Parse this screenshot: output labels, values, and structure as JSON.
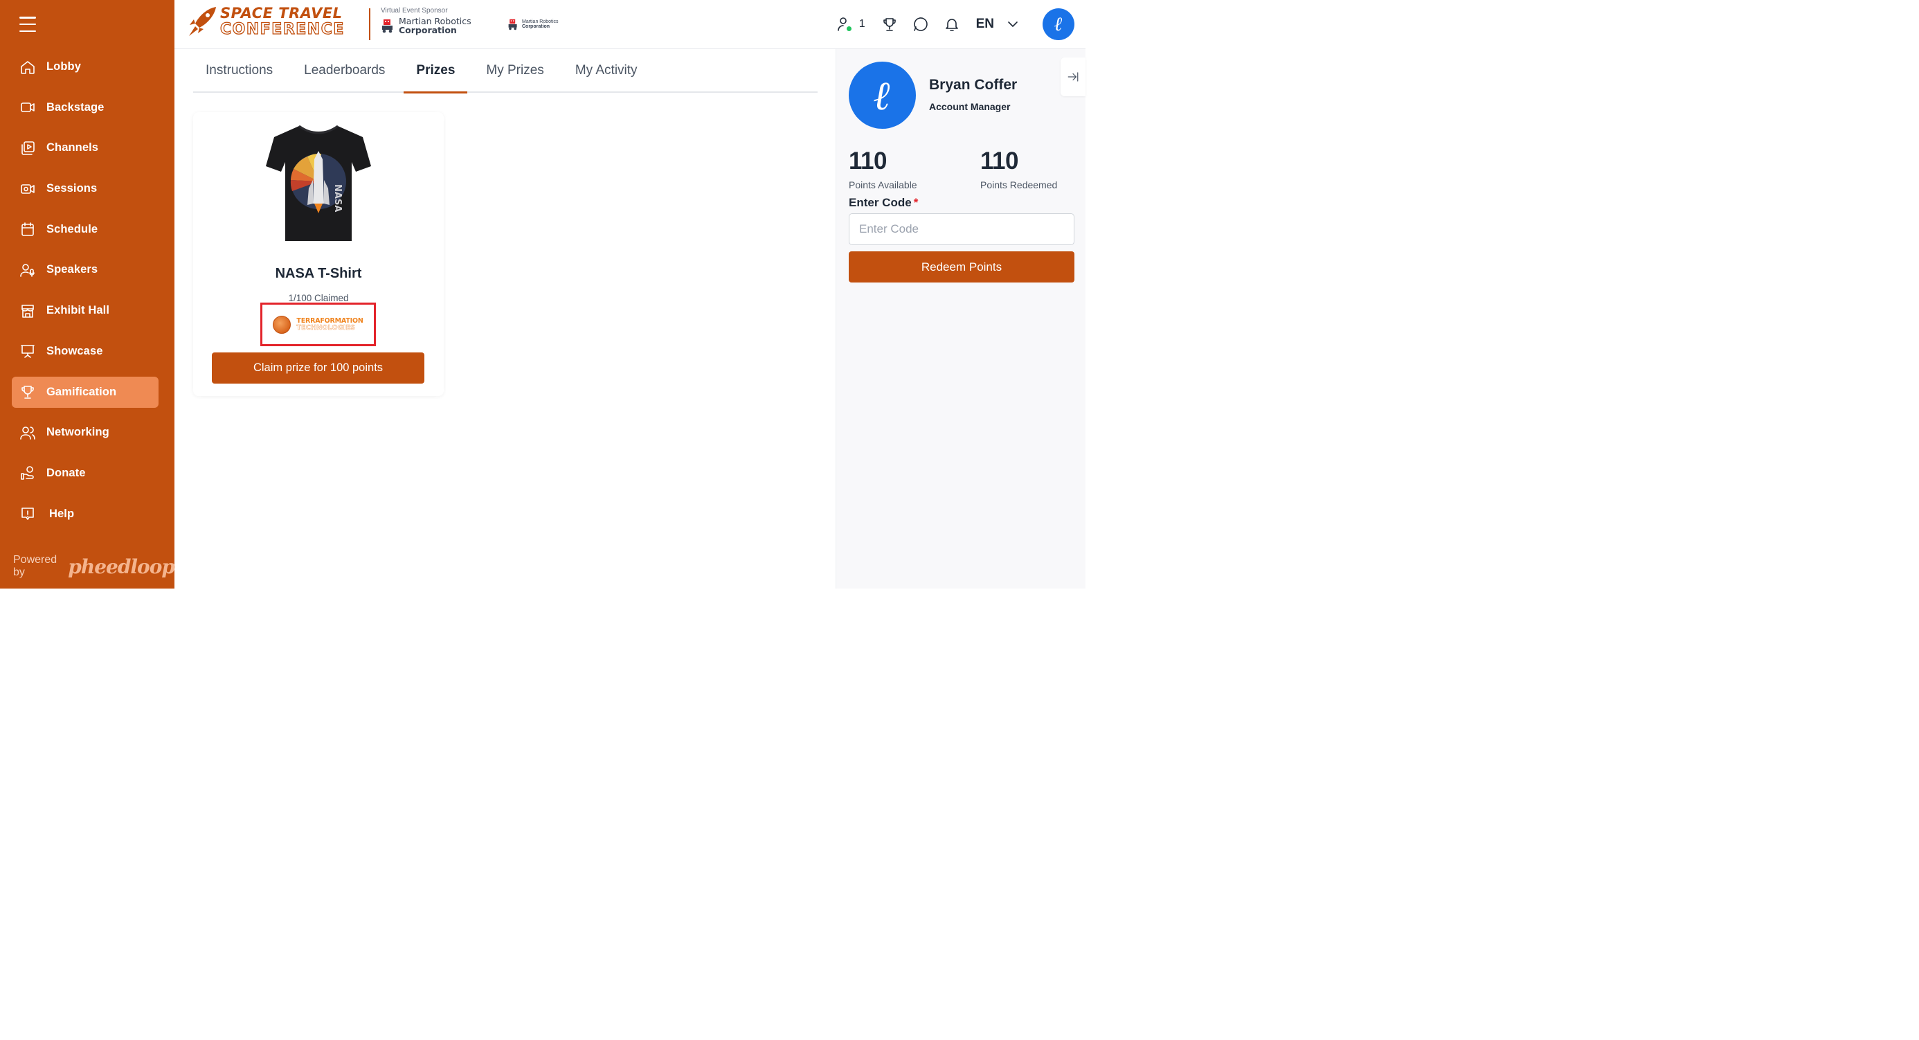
{
  "brand": {
    "line1": "SPACE TRAVEL",
    "line2": "CONFERENCE",
    "sponsor_label": "Virtual Event Sponsor",
    "sponsor_name_1": "Martian Robotics",
    "sponsor_name_2": "Corporation",
    "sponsor2_name_1": "Martian Robotics",
    "sponsor2_name_2": "Corporation"
  },
  "header": {
    "online_count": "1",
    "language": "EN",
    "avatar_letter": "ℓ"
  },
  "sidebar": {
    "items": [
      {
        "label": "Lobby",
        "icon": "home-icon"
      },
      {
        "label": "Backstage",
        "icon": "video-icon"
      },
      {
        "label": "Channels",
        "icon": "channels-icon"
      },
      {
        "label": "Sessions",
        "icon": "camera-icon"
      },
      {
        "label": "Schedule",
        "icon": "calendar-icon"
      },
      {
        "label": "Speakers",
        "icon": "speaker-icon"
      },
      {
        "label": "Exhibit Hall",
        "icon": "booth-icon"
      },
      {
        "label": "Showcase",
        "icon": "presentation-icon"
      },
      {
        "label": "Gamification",
        "icon": "trophy-icon",
        "active": true
      },
      {
        "label": "Networking",
        "icon": "people-icon"
      },
      {
        "label": "Donate",
        "icon": "donate-icon"
      },
      {
        "label": "Help",
        "icon": "help-icon"
      }
    ],
    "powered_by": "Powered by",
    "powered_logo": "pheedloop"
  },
  "tabs": [
    {
      "label": "Instructions"
    },
    {
      "label": "Leaderboards"
    },
    {
      "label": "Prizes",
      "active": true
    },
    {
      "label": "My Prizes"
    },
    {
      "label": "My Activity"
    }
  ],
  "prize": {
    "title": "NASA T-Shirt",
    "claimed": "1/100 Claimed",
    "sponsor_line1": "TERRAFORMATION",
    "sponsor_line2": "TECHNOLOGIES",
    "shirt_text": "NASA",
    "claim_button": "Claim prize for 100 points"
  },
  "profile": {
    "avatar_letter": "ℓ",
    "name": "Bryan Coffer",
    "role": "Account Manager",
    "points_available": "110",
    "points_available_label": "Points Available",
    "points_redeemed": "110",
    "points_redeemed_label": "Points Redeemed",
    "code_label": "Enter Code",
    "code_required": "*",
    "code_placeholder": "Enter Code",
    "code_value": "",
    "redeem_button": "Redeem Points"
  },
  "colors": {
    "brand": "#c2500f",
    "active_nav": "#ef8a53",
    "avatar": "#1a73e8",
    "highlight_box": "#e3242b"
  }
}
